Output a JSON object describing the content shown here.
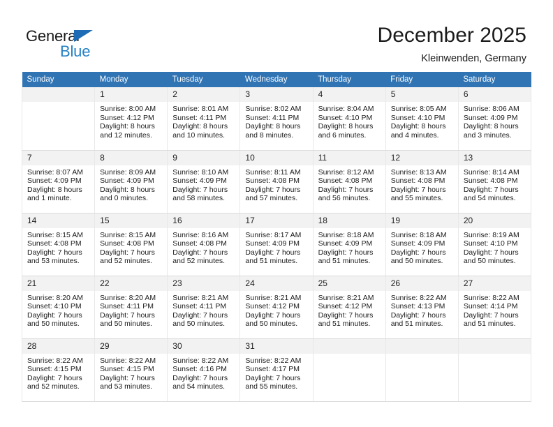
{
  "brand": {
    "name_part1": "General",
    "name_part2": "Blue",
    "triangle_color": "#1e6cb5",
    "blue_text_color": "#2581c4"
  },
  "header": {
    "title": "December 2025",
    "location": "Kleinwenden, Germany",
    "header_bg": "#3074b4",
    "header_text_color": "#ffffff",
    "daynum_bg": "#f2f2f2"
  },
  "weekdays": [
    "Sunday",
    "Monday",
    "Tuesday",
    "Wednesday",
    "Thursday",
    "Friday",
    "Saturday"
  ],
  "weeks": [
    [
      {
        "day": "",
        "lines": []
      },
      {
        "day": "1",
        "lines": [
          "Sunrise: 8:00 AM",
          "Sunset: 4:12 PM",
          "Daylight: 8 hours",
          "and 12 minutes."
        ]
      },
      {
        "day": "2",
        "lines": [
          "Sunrise: 8:01 AM",
          "Sunset: 4:11 PM",
          "Daylight: 8 hours",
          "and 10 minutes."
        ]
      },
      {
        "day": "3",
        "lines": [
          "Sunrise: 8:02 AM",
          "Sunset: 4:11 PM",
          "Daylight: 8 hours",
          "and 8 minutes."
        ]
      },
      {
        "day": "4",
        "lines": [
          "Sunrise: 8:04 AM",
          "Sunset: 4:10 PM",
          "Daylight: 8 hours",
          "and 6 minutes."
        ]
      },
      {
        "day": "5",
        "lines": [
          "Sunrise: 8:05 AM",
          "Sunset: 4:10 PM",
          "Daylight: 8 hours",
          "and 4 minutes."
        ]
      },
      {
        "day": "6",
        "lines": [
          "Sunrise: 8:06 AM",
          "Sunset: 4:09 PM",
          "Daylight: 8 hours",
          "and 3 minutes."
        ]
      }
    ],
    [
      {
        "day": "7",
        "lines": [
          "Sunrise: 8:07 AM",
          "Sunset: 4:09 PM",
          "Daylight: 8 hours",
          "and 1 minute."
        ]
      },
      {
        "day": "8",
        "lines": [
          "Sunrise: 8:09 AM",
          "Sunset: 4:09 PM",
          "Daylight: 8 hours",
          "and 0 minutes."
        ]
      },
      {
        "day": "9",
        "lines": [
          "Sunrise: 8:10 AM",
          "Sunset: 4:09 PM",
          "Daylight: 7 hours",
          "and 58 minutes."
        ]
      },
      {
        "day": "10",
        "lines": [
          "Sunrise: 8:11 AM",
          "Sunset: 4:08 PM",
          "Daylight: 7 hours",
          "and 57 minutes."
        ]
      },
      {
        "day": "11",
        "lines": [
          "Sunrise: 8:12 AM",
          "Sunset: 4:08 PM",
          "Daylight: 7 hours",
          "and 56 minutes."
        ]
      },
      {
        "day": "12",
        "lines": [
          "Sunrise: 8:13 AM",
          "Sunset: 4:08 PM",
          "Daylight: 7 hours",
          "and 55 minutes."
        ]
      },
      {
        "day": "13",
        "lines": [
          "Sunrise: 8:14 AM",
          "Sunset: 4:08 PM",
          "Daylight: 7 hours",
          "and 54 minutes."
        ]
      }
    ],
    [
      {
        "day": "14",
        "lines": [
          "Sunrise: 8:15 AM",
          "Sunset: 4:08 PM",
          "Daylight: 7 hours",
          "and 53 minutes."
        ]
      },
      {
        "day": "15",
        "lines": [
          "Sunrise: 8:15 AM",
          "Sunset: 4:08 PM",
          "Daylight: 7 hours",
          "and 52 minutes."
        ]
      },
      {
        "day": "16",
        "lines": [
          "Sunrise: 8:16 AM",
          "Sunset: 4:08 PM",
          "Daylight: 7 hours",
          "and 52 minutes."
        ]
      },
      {
        "day": "17",
        "lines": [
          "Sunrise: 8:17 AM",
          "Sunset: 4:09 PM",
          "Daylight: 7 hours",
          "and 51 minutes."
        ]
      },
      {
        "day": "18",
        "lines": [
          "Sunrise: 8:18 AM",
          "Sunset: 4:09 PM",
          "Daylight: 7 hours",
          "and 51 minutes."
        ]
      },
      {
        "day": "19",
        "lines": [
          "Sunrise: 8:18 AM",
          "Sunset: 4:09 PM",
          "Daylight: 7 hours",
          "and 50 minutes."
        ]
      },
      {
        "day": "20",
        "lines": [
          "Sunrise: 8:19 AM",
          "Sunset: 4:10 PM",
          "Daylight: 7 hours",
          "and 50 minutes."
        ]
      }
    ],
    [
      {
        "day": "21",
        "lines": [
          "Sunrise: 8:20 AM",
          "Sunset: 4:10 PM",
          "Daylight: 7 hours",
          "and 50 minutes."
        ]
      },
      {
        "day": "22",
        "lines": [
          "Sunrise: 8:20 AM",
          "Sunset: 4:11 PM",
          "Daylight: 7 hours",
          "and 50 minutes."
        ]
      },
      {
        "day": "23",
        "lines": [
          "Sunrise: 8:21 AM",
          "Sunset: 4:11 PM",
          "Daylight: 7 hours",
          "and 50 minutes."
        ]
      },
      {
        "day": "24",
        "lines": [
          "Sunrise: 8:21 AM",
          "Sunset: 4:12 PM",
          "Daylight: 7 hours",
          "and 50 minutes."
        ]
      },
      {
        "day": "25",
        "lines": [
          "Sunrise: 8:21 AM",
          "Sunset: 4:12 PM",
          "Daylight: 7 hours",
          "and 51 minutes."
        ]
      },
      {
        "day": "26",
        "lines": [
          "Sunrise: 8:22 AM",
          "Sunset: 4:13 PM",
          "Daylight: 7 hours",
          "and 51 minutes."
        ]
      },
      {
        "day": "27",
        "lines": [
          "Sunrise: 8:22 AM",
          "Sunset: 4:14 PM",
          "Daylight: 7 hours",
          "and 51 minutes."
        ]
      }
    ],
    [
      {
        "day": "28",
        "lines": [
          "Sunrise: 8:22 AM",
          "Sunset: 4:15 PM",
          "Daylight: 7 hours",
          "and 52 minutes."
        ]
      },
      {
        "day": "29",
        "lines": [
          "Sunrise: 8:22 AM",
          "Sunset: 4:15 PM",
          "Daylight: 7 hours",
          "and 53 minutes."
        ]
      },
      {
        "day": "30",
        "lines": [
          "Sunrise: 8:22 AM",
          "Sunset: 4:16 PM",
          "Daylight: 7 hours",
          "and 54 minutes."
        ]
      },
      {
        "day": "31",
        "lines": [
          "Sunrise: 8:22 AM",
          "Sunset: 4:17 PM",
          "Daylight: 7 hours",
          "and 55 minutes."
        ]
      },
      {
        "day": "",
        "lines": []
      },
      {
        "day": "",
        "lines": []
      },
      {
        "day": "",
        "lines": []
      }
    ]
  ]
}
